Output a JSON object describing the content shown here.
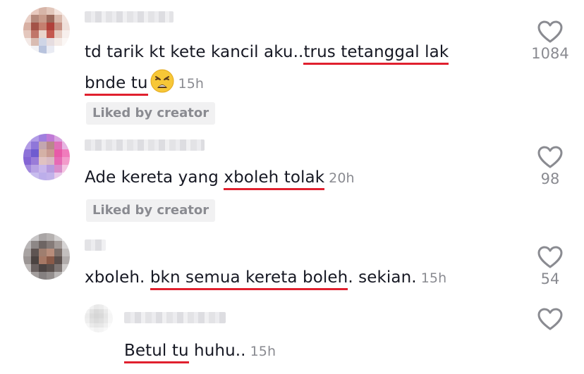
{
  "comments": [
    {
      "username": "",
      "text_pre": "td tarik kt kete kancil aku..",
      "text_u1": "trus tetanggal lak",
      "text_u2": "bnde tu",
      "emoji": "weary-face",
      "time": "15h",
      "liked_by_creator": "Liked by creator",
      "likes": "1084"
    },
    {
      "username": "",
      "text_pre": "Ade kereta yang ",
      "text_u": "xboleh tolak",
      "time": "20h",
      "liked_by_creator": "Liked by creator",
      "likes": "98"
    },
    {
      "username": "",
      "text_pre": "xboleh. ",
      "text_u": "bkn semua kereta boleh",
      "text_post": ". sekian.",
      "time": "15h",
      "likes": "54"
    }
  ],
  "reply": {
    "username": "",
    "text_u": "Betul tu",
    "text_post": " huhu..",
    "time": "15h",
    "likes": ""
  },
  "colors": {
    "underline": "#e0202e",
    "muted": "#8a8b91",
    "badge_bg": "#f1f1f2"
  }
}
